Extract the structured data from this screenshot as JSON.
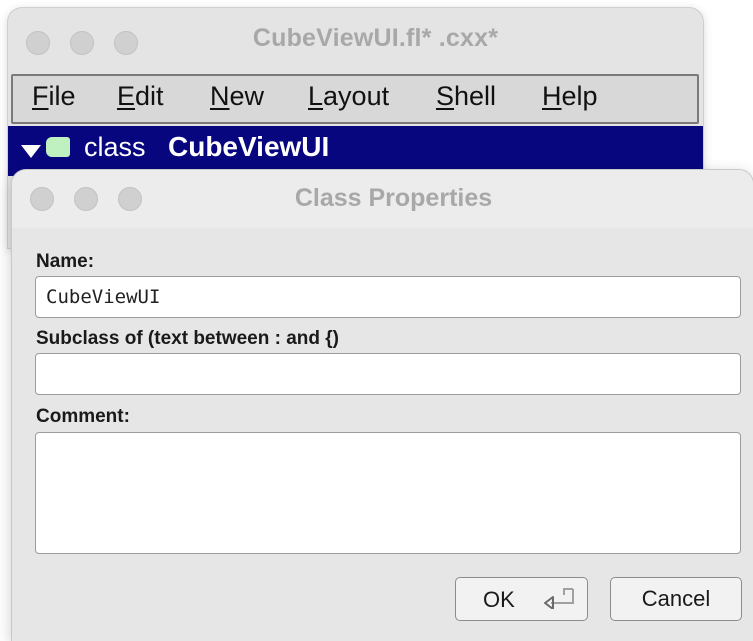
{
  "main_window": {
    "title": "CubeViewUI.fl*  .cxx*",
    "menu": [
      {
        "mnemonic": "F",
        "rest": "ile"
      },
      {
        "mnemonic": "E",
        "rest": "dit"
      },
      {
        "mnemonic": "N",
        "rest": "ew"
      },
      {
        "mnemonic": "L",
        "rest": "ayout"
      },
      {
        "mnemonic": "S",
        "rest": "hell"
      },
      {
        "mnemonic": "H",
        "rest": "elp"
      }
    ],
    "tree_row": {
      "kind": "class",
      "name": "CubeViewUI",
      "selection_color": "#07067f",
      "icon": "class-icon"
    }
  },
  "dialog": {
    "title": "Class Properties",
    "name_label": "Name:",
    "name_value": "CubeViewUI",
    "subclass_label": "Subclass of (text between : and {)",
    "subclass_value": "",
    "comment_label": "Comment:",
    "comment_value": "",
    "ok_label": "OK",
    "ok_icon": "return-icon",
    "cancel_label": "Cancel"
  }
}
